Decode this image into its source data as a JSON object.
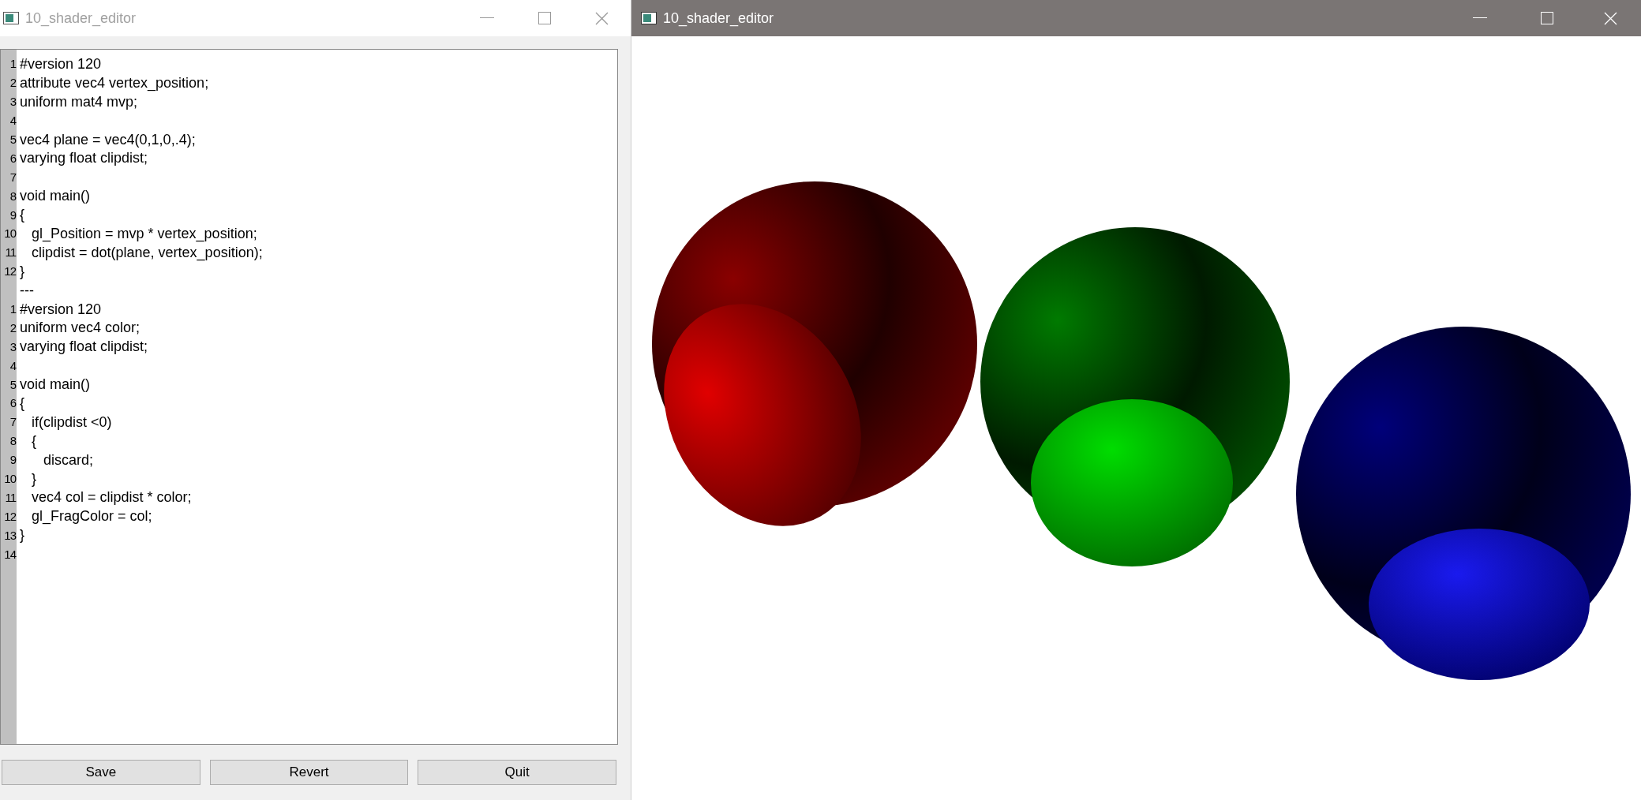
{
  "editor_window": {
    "title": "10_shader_editor",
    "lines": [
      {
        "number": "1",
        "text": "#version 120"
      },
      {
        "number": "2",
        "text": "attribute vec4 vertex_position;"
      },
      {
        "number": "3",
        "text": "uniform mat4 mvp;"
      },
      {
        "number": "4"
      },
      {
        "number": "5",
        "text": "vec4 plane = vec4(0,1,0,.4);"
      },
      {
        "number": "6",
        "text": "varying float clipdist;"
      },
      {
        "number": "7"
      },
      {
        "number": "8",
        "text": "void main()"
      },
      {
        "number": "9",
        "text": "{"
      },
      {
        "number": "10",
        "text": "   gl_Position = mvp * vertex_position;"
      },
      {
        "number": "11",
        "text": "   clipdist = dot(plane, vertex_position);"
      },
      {
        "number": "12",
        "text": "}"
      },
      {
        "text": "---"
      },
      {
        "number": "1",
        "text": "#version 120"
      },
      {
        "number": "2",
        "text": "uniform vec4 color;"
      },
      {
        "number": "3",
        "text": "varying float clipdist;"
      },
      {
        "number": "4"
      },
      {
        "number": "5",
        "text": "void main()"
      },
      {
        "number": "6",
        "text": "{"
      },
      {
        "number": "7",
        "text": "   if(clipdist <0)"
      },
      {
        "number": "8",
        "text": "   {"
      },
      {
        "number": "9",
        "text": "      discard;"
      },
      {
        "number": "10",
        "text": "   }"
      },
      {
        "number": "11",
        "text": "   vec4 col = clipdist * color;"
      },
      {
        "number": "12",
        "text": "   gl_FragColor = col;"
      },
      {
        "number": "13",
        "text": "}"
      },
      {
        "number": "14"
      }
    ],
    "buttons": [
      "Save",
      "Revert",
      "Quit"
    ]
  },
  "render_window": {
    "title": "10_shader_editor"
  }
}
